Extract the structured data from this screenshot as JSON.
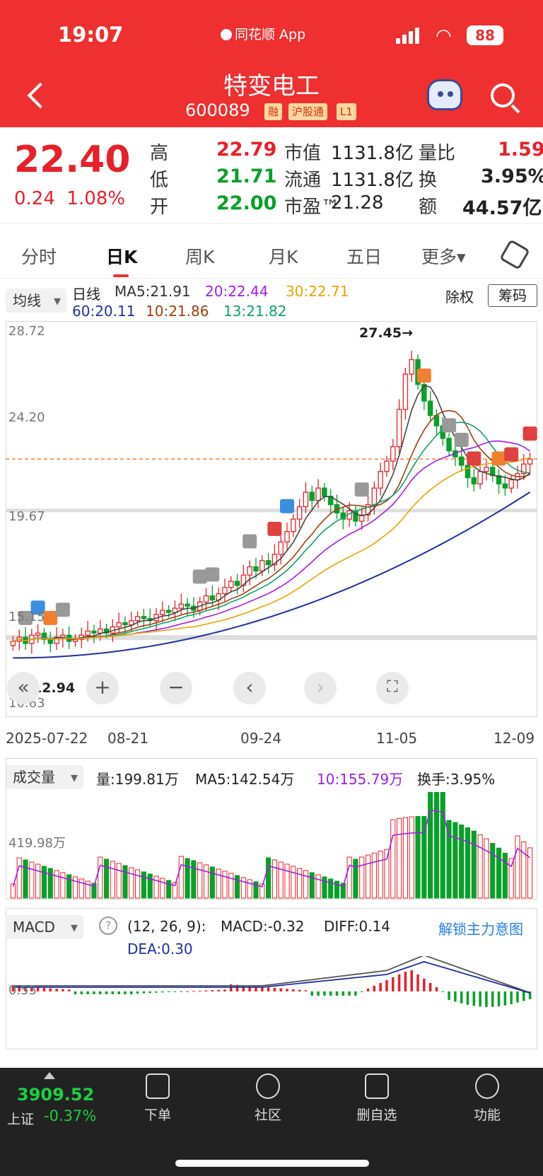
{
  "status": {
    "time": "19:07",
    "app_name": "同花顺 App",
    "battery": "88"
  },
  "header": {
    "name": "特变电工",
    "code": "600089",
    "tags": [
      "融",
      "沪股通",
      "L1"
    ]
  },
  "quote": {
    "price": "22.40",
    "change": "0.24",
    "change_pct": "1.08%",
    "rows": [
      {
        "l1": "高",
        "v1": "22.79",
        "c1": "red",
        "l2": "市值",
        "v2": "1131.8亿",
        "l3": "量比",
        "v3": "1.59",
        "c3": "red"
      },
      {
        "l1": "低",
        "v1": "21.71",
        "c1": "green",
        "l2": "流通",
        "v2": "1131.8亿",
        "l3": "换",
        "v3": "3.95%",
        "c3": "dark"
      },
      {
        "l1": "开",
        "v1": "22.00",
        "c1": "green",
        "l2": "市盈™",
        "v2": "21.28",
        "l3": "额",
        "v3": "44.57亿",
        "c3": "dark"
      }
    ]
  },
  "tabs": [
    "分时",
    "日K",
    "周K",
    "月K",
    "五日",
    "更多▾"
  ],
  "kline": {
    "indicator": "均线",
    "period": "日线",
    "ex_right": "除权",
    "chips": "筹码",
    "ma": [
      {
        "t": "MA5:21.91",
        "c": "#333"
      },
      {
        "t": "20:22.44",
        "c": "#a020e0"
      },
      {
        "t": "30:22.71",
        "c": "#e8a400"
      },
      {
        "t": "60:20.11",
        "c": "#2030a0"
      },
      {
        "t": "10:21.86",
        "c": "#a04010"
      },
      {
        "t": "13:21.82",
        "c": "#10a070"
      }
    ],
    "yticks": [
      "28.72",
      "24.20",
      "19.67",
      "15.15",
      "10.63"
    ],
    "high_mark": "27.45→",
    "low_mark": "12.94",
    "xlabels": [
      "2025-07-22",
      "08-21",
      "09-24",
      "11-05",
      "12-09"
    ]
  },
  "volume": {
    "indicator": "成交量",
    "vol": "量:199.81万",
    "ma5": "MA5:142.54万",
    "ma10": "10:155.79万",
    "turnover": "换手:3.95%",
    "ytick": "419.98万"
  },
  "macd": {
    "indicator": "MACD",
    "params": "(12, 26, 9):",
    "macd": "MACD:-0.32",
    "diff": "DIFF:0.14",
    "dea": "DEA:0.30",
    "unlock": "解锁主力意图",
    "ytick": "0.55"
  },
  "bottom": {
    "index_value": "3909.52",
    "index_name": "上证",
    "index_chg": "-0.37%",
    "nav": [
      "下单",
      "社区",
      "删自选",
      "功能"
    ]
  },
  "chart_data": {
    "type": "candlestick",
    "title": "日K",
    "x_labels": [
      "2025-07-22",
      "08-21",
      "09-24",
      "11-05",
      "12-09"
    ],
    "ylim": [
      10.63,
      28.72
    ],
    "yticks": [
      28.72,
      24.2,
      19.67,
      15.15,
      10.63
    ],
    "close": [
      13.6,
      13.8,
      13.5,
      13.9,
      14.0,
      13.7,
      13.5,
      13.8,
      13.9,
      13.6,
      13.7,
      13.9,
      14.1,
      14.0,
      14.2,
      14.0,
      14.3,
      14.5,
      14.4,
      14.6,
      14.8,
      14.7,
      14.6,
      14.9,
      15.1,
      15.0,
      15.2,
      15.4,
      15.3,
      15.1,
      15.5,
      15.8,
      15.6,
      15.9,
      16.2,
      16.5,
      16.3,
      16.8,
      17.2,
      17.0,
      17.5,
      17.3,
      17.8,
      18.4,
      18.9,
      19.5,
      20.1,
      20.8,
      20.4,
      21.0,
      20.6,
      20.2,
      19.8,
      19.5,
      19.9,
      19.4,
      19.7,
      20.2,
      21.0,
      21.8,
      22.3,
      23.0,
      24.8,
      26.5,
      27.2,
      26.0,
      25.2,
      24.5,
      24.0,
      23.4,
      22.8,
      22.5,
      22.1,
      21.5,
      21.2,
      21.8,
      22.0,
      21.6,
      21.2,
      21.0,
      21.4,
      21.7,
      22.16,
      22.4
    ]
  },
  "volume_data": {
    "ma5": "142.54万",
    "latest": "199.81万"
  }
}
